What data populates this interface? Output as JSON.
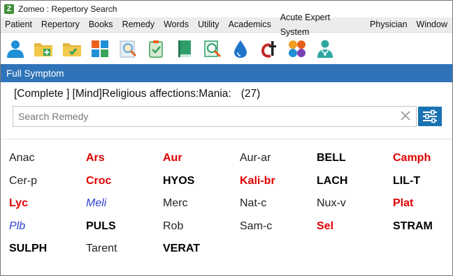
{
  "window": {
    "title": "Zomeo : Repertory Search",
    "app_icon": "zomeo-logo-icon"
  },
  "menu": [
    "Patient",
    "Repertory",
    "Books",
    "Remedy",
    "Words",
    "Utility",
    "Academics",
    "Acute Expert System",
    "Physician",
    "Window"
  ],
  "toolbar": {
    "buttons": [
      {
        "icon": "user-icon",
        "color": "#1f8fd6"
      },
      {
        "icon": "folder-add-icon",
        "color": "#e6b63c"
      },
      {
        "icon": "folder-check-icon",
        "color": "#e6b63c"
      },
      {
        "icon": "grid-tiles-icon",
        "color": "#e8601c"
      },
      {
        "icon": "search-document-icon",
        "color": "#5aa6e0"
      },
      {
        "icon": "clipboard-check-icon",
        "color": "#3aa35a"
      },
      {
        "icon": "book-icon",
        "color": "#2e9e6a"
      },
      {
        "icon": "search-book-icon",
        "color": "#2e9e6a"
      },
      {
        "icon": "drop-icon",
        "color": "#1f74c8"
      },
      {
        "icon": "ct-logo-icon",
        "color": "#c62828"
      },
      {
        "icon": "molecule-icon",
        "color": "#f0a020"
      },
      {
        "icon": "doctor-icon",
        "color": "#2ea6a0"
      }
    ]
  },
  "panel": {
    "title": "Full Symptom"
  },
  "symptom": {
    "text": "[Complete ] [Mind]Religious affections:Mania:",
    "count": "(27)"
  },
  "search": {
    "placeholder": "Search Remedy",
    "value": ""
  },
  "colors": {
    "header_bg": "#2f73b8",
    "filter_button": "#1a72b3",
    "grade_1": "#222222",
    "grade_2": "#2c3fd6",
    "grade_3": "#e00000",
    "grade_4": "#000000"
  },
  "remedies": [
    {
      "name": "Anac",
      "grade": 1
    },
    {
      "name": "Ars",
      "grade": 3
    },
    {
      "name": "Aur",
      "grade": 3
    },
    {
      "name": "Aur-ar",
      "grade": 1
    },
    {
      "name": "BELL",
      "grade": 4
    },
    {
      "name": "Camph",
      "grade": 3
    },
    {
      "name": "Cer-p",
      "grade": 1
    },
    {
      "name": "Croc",
      "grade": 3
    },
    {
      "name": "HYOS",
      "grade": 4
    },
    {
      "name": "Kali-br",
      "grade": 3
    },
    {
      "name": "LACH",
      "grade": 4
    },
    {
      "name": "LIL-T",
      "grade": 4
    },
    {
      "name": "Lyc",
      "grade": 3
    },
    {
      "name": "Meli",
      "grade": 2
    },
    {
      "name": "Merc",
      "grade": 1
    },
    {
      "name": "Nat-c",
      "grade": 1
    },
    {
      "name": "Nux-v",
      "grade": 1
    },
    {
      "name": "Plat",
      "grade": 3
    },
    {
      "name": "Plb",
      "grade": 2
    },
    {
      "name": "PULS",
      "grade": 4
    },
    {
      "name": "Rob",
      "grade": 1
    },
    {
      "name": "Sam-c",
      "grade": 1
    },
    {
      "name": "Sel",
      "grade": 3
    },
    {
      "name": "STRAM",
      "grade": 4
    },
    {
      "name": "SULPH",
      "grade": 4
    },
    {
      "name": "Tarent",
      "grade": 1
    },
    {
      "name": "VERAT",
      "grade": 4
    }
  ]
}
